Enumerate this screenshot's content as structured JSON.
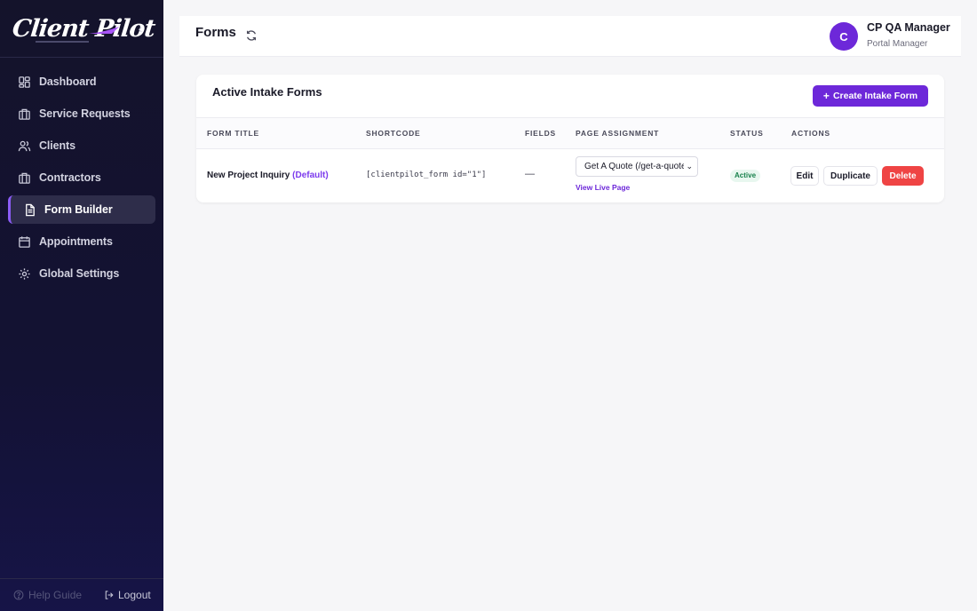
{
  "brand": {
    "logo_text": "Client Pilot"
  },
  "sidebar": {
    "items": [
      {
        "label": "Dashboard",
        "icon": "dashboard-icon"
      },
      {
        "label": "Service Requests",
        "icon": "briefcase-icon"
      },
      {
        "label": "Clients",
        "icon": "users-icon"
      },
      {
        "label": "Contractors",
        "icon": "briefcase-icon"
      },
      {
        "label": "Form Builder",
        "icon": "document-icon",
        "active": true
      },
      {
        "label": "Appointments",
        "icon": "calendar-icon"
      },
      {
        "label": "Global Settings",
        "icon": "gear-icon"
      }
    ],
    "help_label": "Help Guide",
    "logout_label": "Logout"
  },
  "header": {
    "title": "Forms",
    "user": {
      "initial": "C",
      "name": "CP QA Manager",
      "role": "Portal Manager"
    }
  },
  "card": {
    "title": "Active Intake Forms",
    "create_button": "Create Intake Form",
    "columns": [
      "FORM TITLE",
      "SHORTCODE",
      "FIELDS",
      "PAGE ASSIGNMENT",
      "STATUS",
      "ACTIONS"
    ],
    "rows": [
      {
        "title": "New Project Inquiry",
        "default_tag": "(Default)",
        "shortcode": "[clientpilot_form id=\"1\"]",
        "fields": "—",
        "page_assignment": "Get A Quote (/get-a-quote/)",
        "view_live": "View Live Page",
        "status": "Active",
        "actions": {
          "edit": "Edit",
          "duplicate": "Duplicate",
          "delete": "Delete"
        }
      }
    ]
  },
  "colors": {
    "accent": "#6d28d9",
    "danger": "#ef4444",
    "sidebar_bg": "#14132b",
    "active_status": "#17804b"
  }
}
